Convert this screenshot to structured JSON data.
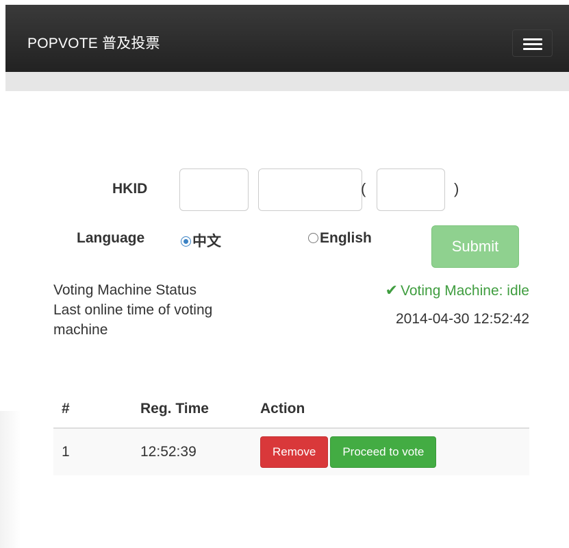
{
  "navbar": {
    "brand": "POPVOTE 普及投票",
    "menu_icon": "hamburger-menu-icon"
  },
  "form": {
    "hkid_label": "HKID",
    "hkid_fields": {
      "field1_value": "",
      "field2_value": "",
      "check_digit_value": ""
    },
    "paren_open": "(",
    "paren_close": ")",
    "language_label": "Language",
    "language_options": [
      {
        "label": "中文",
        "selected": true
      },
      {
        "label": "English",
        "selected": false
      }
    ],
    "submit_label": "Submit"
  },
  "status": {
    "machine_status_label": "Voting Machine Status",
    "machine_status_value": "Voting Machine: idle",
    "status_icon": "check-icon",
    "last_online_label": "Last online time of voting machine",
    "last_online_value": "2014-04-30 12:52:42"
  },
  "queue": {
    "headers": [
      "#",
      "Reg. Time",
      "Action"
    ],
    "rows": [
      {
        "index": "1",
        "reg_time": "12:52:39",
        "remove_label": "Remove",
        "proceed_label": "Proceed to vote"
      }
    ]
  },
  "colors": {
    "navbar_bg": "#2b2b2b",
    "success": "#43ac43",
    "danger": "#d9383a",
    "submit_disabled": "#8fd18f",
    "radio_accent": "#3b82c4"
  }
}
